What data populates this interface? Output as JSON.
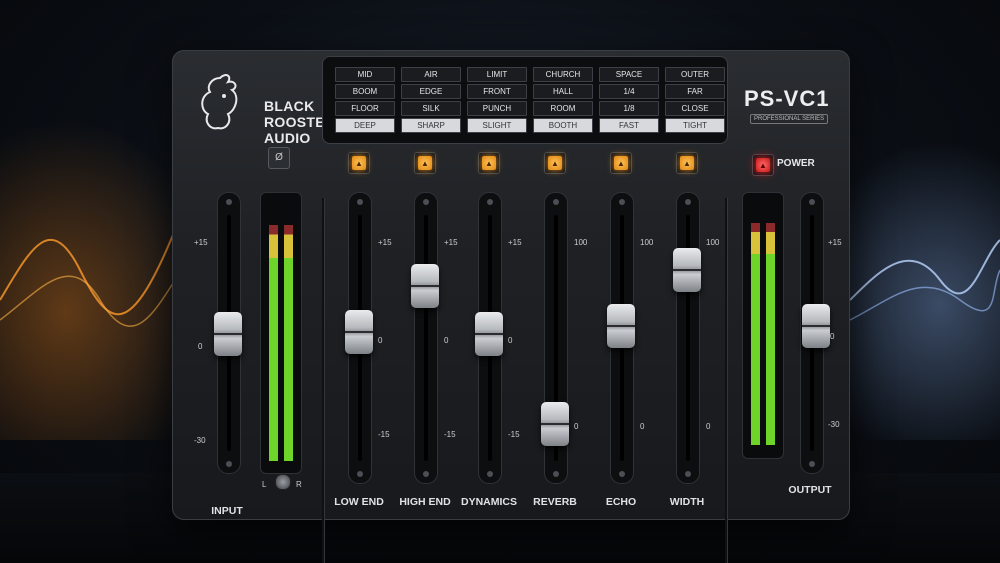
{
  "brand": {
    "line1": "BLACK",
    "line2": "ROOSTER",
    "line3": "AUDIO"
  },
  "model": {
    "name": "PS-VC1",
    "subtitle": "PROFESSIONAL SERIES"
  },
  "phase_button": {
    "label": "Ø"
  },
  "power": {
    "label": "POWER",
    "on": true
  },
  "presets": [
    {
      "options": [
        "MID",
        "BOOM",
        "FLOOR",
        "DEEP"
      ],
      "selected": "DEEP"
    },
    {
      "options": [
        "AIR",
        "EDGE",
        "SILK",
        "SHARP"
      ],
      "selected": "SHARP"
    },
    {
      "options": [
        "LIMIT",
        "FRONT",
        "PUNCH",
        "SLIGHT"
      ],
      "selected": "SLIGHT"
    },
    {
      "options": [
        "CHURCH",
        "HALL",
        "ROOM",
        "BOOTH"
      ],
      "selected": "BOOTH"
    },
    {
      "options": [
        "SPACE",
        "1/4",
        "1/8",
        "FAST"
      ],
      "selected": "FAST"
    },
    {
      "options": [
        "OUTER",
        "FAR",
        "CLOSE",
        "TIGHT"
      ],
      "selected": "TIGHT"
    }
  ],
  "input": {
    "label": "INPUT",
    "scale": [
      "+15",
      "0",
      "-30"
    ],
    "pan_left": "L",
    "pan_right": "R"
  },
  "output": {
    "label": "OUTPUT",
    "scale": [
      "+15",
      "0",
      "-30"
    ]
  },
  "channels": [
    {
      "label": "LOW END",
      "scale": [
        "+15",
        "0",
        "-15"
      ]
    },
    {
      "label": "HIGH END",
      "scale": [
        "+15",
        "0",
        "-15"
      ]
    },
    {
      "label": "DYNAMICS",
      "scale": [
        "+15",
        "0",
        "-15"
      ]
    },
    {
      "label": "REVERB",
      "scale": [
        "100",
        "0"
      ]
    },
    {
      "label": "ECHO",
      "scale": [
        "100",
        "0"
      ]
    },
    {
      "label": "WIDTH",
      "scale": [
        "100",
        "0"
      ]
    }
  ],
  "colors": {
    "led_amber": "#f5a623",
    "led_red": "#e52222",
    "meter_green": "#6fd42a"
  }
}
